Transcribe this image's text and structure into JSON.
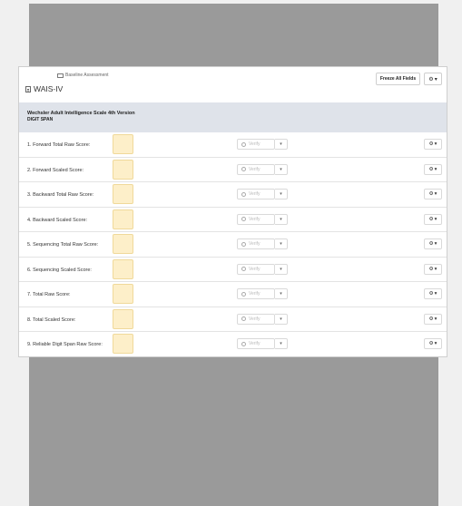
{
  "breadcrumb": {
    "folder_icon": "folder-icon",
    "label": "Baseline Assessment"
  },
  "form": {
    "icon": "document-icon",
    "title": "WAIS-IV"
  },
  "toolbar": {
    "freeze_label": "Freeze All Fields",
    "gear_icon": "gear-icon"
  },
  "section": {
    "title": "Wechsler Adult Intelligence Scale 4th Version",
    "subtitle": "DIGIT SPAN"
  },
  "colors": {
    "score_fill": "#fdefc9",
    "section_bg": "#dfe3ea",
    "backdrop": "#9a9a9a"
  },
  "fields": [
    {
      "label": "1. Forward Total Raw Score:",
      "value": "",
      "verify_label": "Verify"
    },
    {
      "label": "2. Forward Scaled Score:",
      "value": "",
      "verify_label": "Verify"
    },
    {
      "label": "3. Backward Total Raw Score:",
      "value": "",
      "verify_label": "Verify"
    },
    {
      "label": "4. Backward Scaled Score:",
      "value": "",
      "verify_label": "Verify"
    },
    {
      "label": "5. Sequencing Total Raw Score:",
      "value": "",
      "verify_label": "Verify"
    },
    {
      "label": "6. Sequencing Scaled Score:",
      "value": "",
      "verify_label": "Verify"
    },
    {
      "label": "7. Total Raw Score:",
      "value": "",
      "verify_label": "Verify"
    },
    {
      "label": "8. Total Scaled Score:",
      "value": "",
      "verify_label": "Verify"
    },
    {
      "label": "9. Reliable Digit Span Raw Score:",
      "value": "",
      "verify_label": "Verify"
    }
  ]
}
